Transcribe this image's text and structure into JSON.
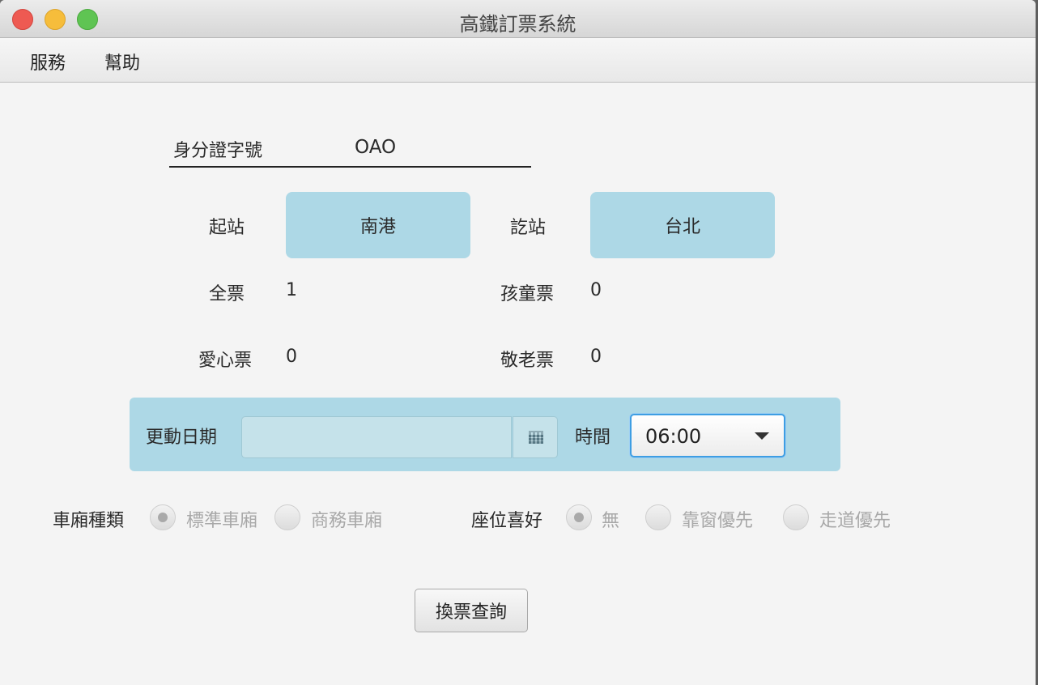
{
  "window": {
    "title": "高鐵訂票系統"
  },
  "menubar": {
    "items": [
      "服務",
      "幫助"
    ]
  },
  "form": {
    "id_label": "身分證字號",
    "id_value": "OAO",
    "origin_label": "起站",
    "origin_value": "南港",
    "dest_label": "訖站",
    "dest_value": "台北",
    "full_ticket_label": "全票",
    "full_ticket_value": "1",
    "child_ticket_label": "孩童票",
    "child_ticket_value": "0",
    "love_ticket_label": "愛心票",
    "love_ticket_value": "0",
    "senior_ticket_label": "敬老票",
    "senior_ticket_value": "0",
    "date_label": "更動日期",
    "date_value": "",
    "time_label": "時間",
    "time_value": "06:00",
    "car_type_label": "車廂種類",
    "car_type_options": [
      "標準車廂",
      "商務車廂"
    ],
    "car_type_selected": "標準車廂",
    "seat_pref_label": "座位喜好",
    "seat_pref_options": [
      "無",
      "靠窗優先",
      "走道優先"
    ],
    "seat_pref_selected": "無",
    "query_button": "換票查詢"
  },
  "colors": {
    "panel_blue": "#add8e6",
    "focus_blue": "#3e9ee3",
    "close": "#ee5a52",
    "minimize": "#f6bd3b",
    "zoom": "#5fc453"
  },
  "icons": [
    "calendar-icon",
    "chevron-down-icon"
  ]
}
